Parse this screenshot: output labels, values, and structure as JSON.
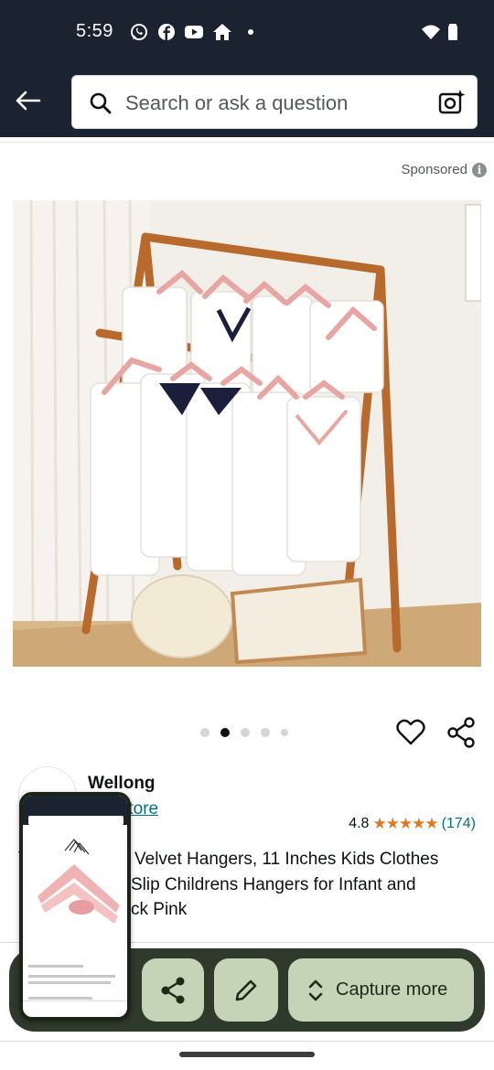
{
  "status_bar": {
    "time": "5:59",
    "left_icons": [
      "whatsapp-icon",
      "facebook-icon",
      "youtube-icon",
      "home-icon",
      "dot-icon"
    ],
    "right_icons": [
      "wifi-icon",
      "battery-icon"
    ]
  },
  "header": {
    "search_placeholder": "Search or ask a question",
    "colors": {
      "background": "#1b2230",
      "search_bg": "#ffffff"
    }
  },
  "listing": {
    "sponsored_label": "Sponsored",
    "carousel": {
      "total_dots": 5,
      "active_index": 1
    },
    "brand_name": "Wellong",
    "store_link": "the Store",
    "rating_value": "4.8",
    "rating_stars": "★★★★★",
    "rating_count": "(174)",
    "title_line1": "Velvet Hangers, 11 Inches Kids Clothes",
    "title_line2": "Slip Childrens Hangers for Infant and",
    "title_line3": "ck Pink",
    "title_prefix_hidden": "V",
    "accent_colors": {
      "link": "#007185",
      "stars": "#de7921"
    }
  },
  "capture_toolbar": {
    "capture_more_label": "Capture more",
    "colors": {
      "bar": "#2f3a2c",
      "button": "#c5d3b6"
    }
  }
}
